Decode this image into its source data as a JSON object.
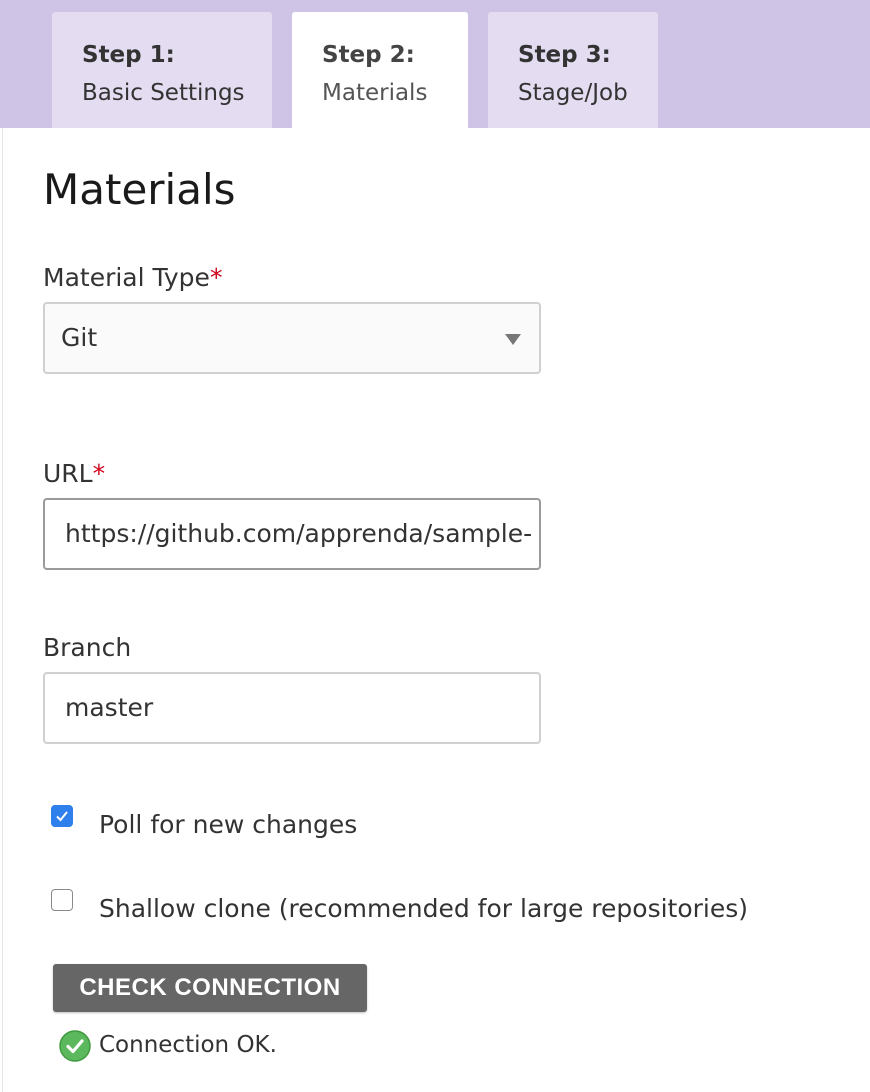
{
  "tabs": [
    {
      "step": "Step 1:",
      "name": "Basic Settings",
      "active": false
    },
    {
      "step": "Step 2:",
      "name": "Materials",
      "active": true
    },
    {
      "step": "Step 3:",
      "name": "Stage/Job",
      "active": false
    }
  ],
  "page": {
    "title": "Materials"
  },
  "material_type": {
    "label": "Material Type",
    "required_mark": "*",
    "value": "Git"
  },
  "url": {
    "label": "URL",
    "required_mark": "*",
    "value": "https://github.com/apprenda/sample-"
  },
  "branch": {
    "label": "Branch",
    "value": "master"
  },
  "options": {
    "poll": {
      "label": "Poll for new changes",
      "checked": true
    },
    "shallow": {
      "label": "Shallow clone (recommended for large repositories)",
      "checked": false
    }
  },
  "check_button": {
    "label": "CHECK CONNECTION"
  },
  "status": {
    "text": "Connection OK.",
    "icon": "check-circle-icon",
    "color": "#5cb85c"
  },
  "colors": {
    "tabbar": "#cfc3e6",
    "tab": "#e4dcf1",
    "required": "#d0021b",
    "checkbox": "#2f80ed",
    "button": "#666666"
  }
}
